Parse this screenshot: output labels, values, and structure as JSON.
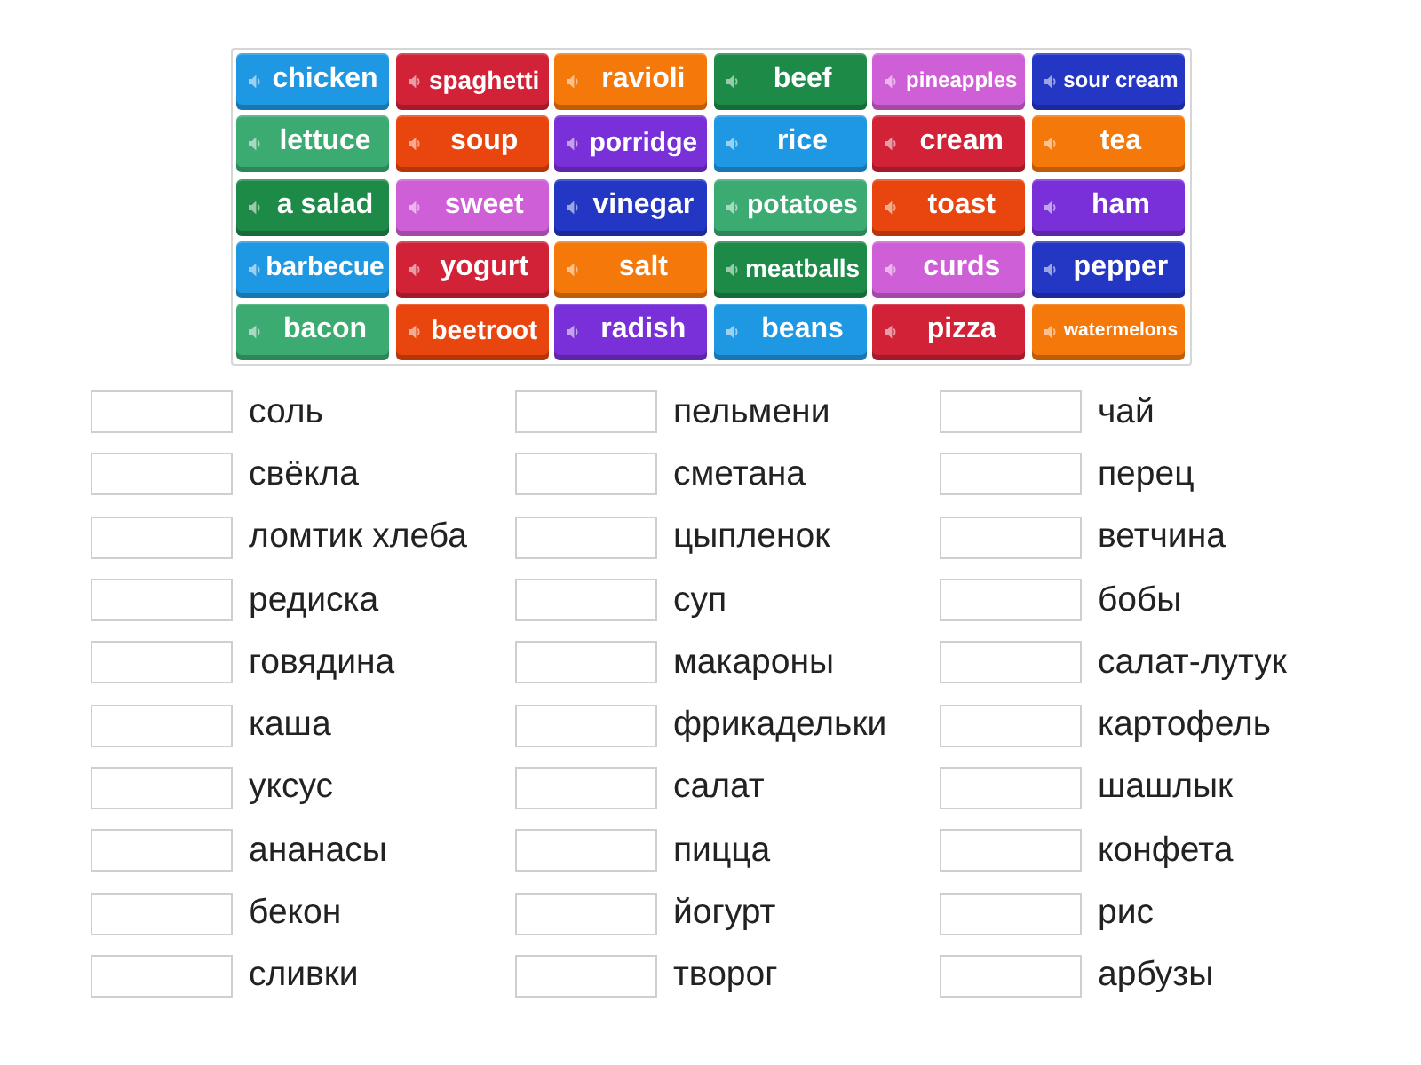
{
  "tiles": [
    {
      "label": "chicken",
      "color": "#1f98e3"
    },
    {
      "label": "spaghetti",
      "color": "#d12238"
    },
    {
      "label": "ravioli",
      "color": "#f5780a"
    },
    {
      "label": "beef",
      "color": "#1d8a48"
    },
    {
      "label": "pineapples",
      "color": "#cf5fd6"
    },
    {
      "label": "sour cream",
      "color": "#2436c4"
    },
    {
      "label": "lettuce",
      "color": "#3bab72"
    },
    {
      "label": "soup",
      "color": "#e9450f"
    },
    {
      "label": "porridge",
      "color": "#7a30d9"
    },
    {
      "label": "rice",
      "color": "#1f98e3"
    },
    {
      "label": "cream",
      "color": "#d12238"
    },
    {
      "label": "tea",
      "color": "#f5780a"
    },
    {
      "label": "a salad",
      "color": "#1d8a48"
    },
    {
      "label": "sweet",
      "color": "#cf5fd6"
    },
    {
      "label": "vinegar",
      "color": "#2436c4"
    },
    {
      "label": "potatoes",
      "color": "#3bab72"
    },
    {
      "label": "toast",
      "color": "#e9450f"
    },
    {
      "label": "ham",
      "color": "#7a30d9"
    },
    {
      "label": "barbecue",
      "color": "#1f98e3"
    },
    {
      "label": "yogurt",
      "color": "#d12238"
    },
    {
      "label": "salt",
      "color": "#f5780a"
    },
    {
      "label": "meatballs",
      "color": "#1d8a48"
    },
    {
      "label": "curds",
      "color": "#cf5fd6"
    },
    {
      "label": "pepper",
      "color": "#2436c4"
    },
    {
      "label": "bacon",
      "color": "#3bab72"
    },
    {
      "label": "beetroot",
      "color": "#e9450f"
    },
    {
      "label": "radish",
      "color": "#7a30d9"
    },
    {
      "label": "beans",
      "color": "#1f98e3"
    },
    {
      "label": "pizza",
      "color": "#d12238"
    },
    {
      "label": "watermelons",
      "color": "#f5780a"
    }
  ],
  "answer_columns": [
    {
      "items": [
        {
          "label": "соль"
        },
        {
          "label": "свёкла"
        },
        {
          "label": "ломтик хлеба"
        },
        {
          "label": "редиска"
        },
        {
          "label": "говядина"
        },
        {
          "label": "каша"
        },
        {
          "label": "уксус"
        },
        {
          "label": "ананасы"
        },
        {
          "label": "бекон"
        },
        {
          "label": "сливки"
        }
      ]
    },
    {
      "items": [
        {
          "label": "пельмени"
        },
        {
          "label": "сметана"
        },
        {
          "label": "цыпленок"
        },
        {
          "label": "суп"
        },
        {
          "label": "макароны"
        },
        {
          "label": "фрикадельки"
        },
        {
          "label": "салат"
        },
        {
          "label": "пицца"
        },
        {
          "label": "йогурт"
        },
        {
          "label": "творог"
        }
      ]
    },
    {
      "items": [
        {
          "label": "чай"
        },
        {
          "label": "перец"
        },
        {
          "label": "ветчина"
        },
        {
          "label": "бобы"
        },
        {
          "label": "салат-лутук"
        },
        {
          "label": "картофель"
        },
        {
          "label": "шашлык"
        },
        {
          "label": "конфета"
        },
        {
          "label": "рис"
        },
        {
          "label": "арбузы"
        }
      ]
    }
  ]
}
